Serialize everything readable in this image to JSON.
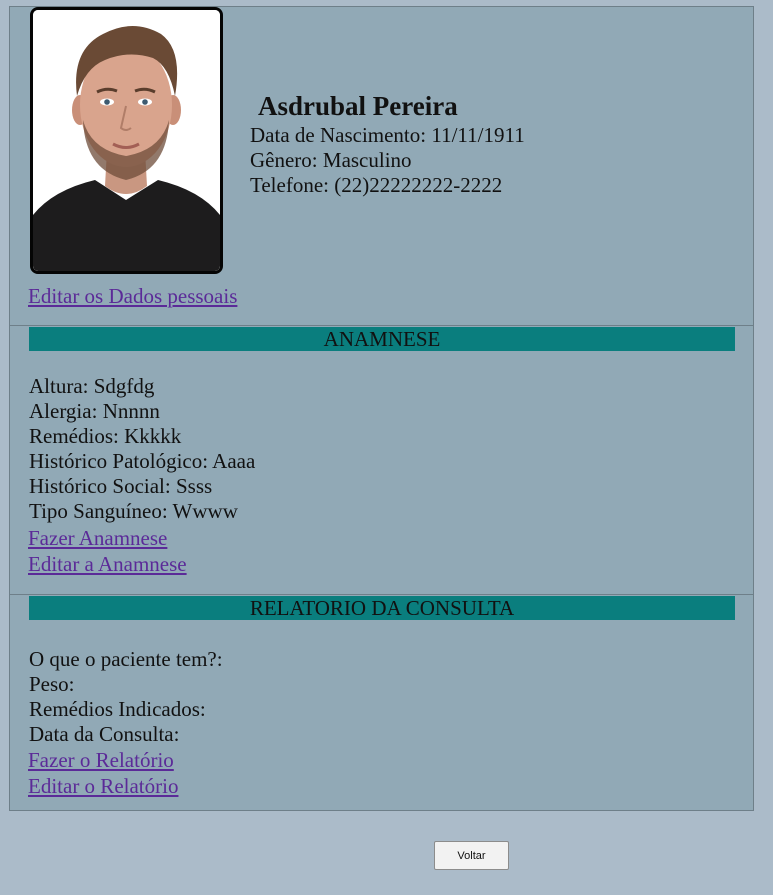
{
  "profile": {
    "name": "Asdrubal Pereira",
    "birth_label": "Data de Nascimento:",
    "birth_value": "11/11/1911",
    "gender_label": "Gênero:",
    "gender_value": "Masculino",
    "phone_label": "Telefone:",
    "phone_value": "(22)22222222-2222",
    "edit_link": "Editar os Dados pessoais"
  },
  "anamnese": {
    "title": "ANAMNESE",
    "fields": [
      {
        "label": "Altura:",
        "value": "Sdgfdg"
      },
      {
        "label": "Alergia:",
        "value": "Nnnnn"
      },
      {
        "label": "Remédios:",
        "value": "Kkkkk"
      },
      {
        "label": "Histórico Patológico:",
        "value": "Aaaa"
      },
      {
        "label": "Histórico Social:",
        "value": "Ssss"
      },
      {
        "label": "Tipo Sanguíneo:",
        "value": "Wwww"
      }
    ],
    "create_link": "Fazer Anamnese",
    "edit_link": "Editar a Anamnese"
  },
  "relatorio": {
    "title": "RELATORIO DA CONSULTA",
    "fields": [
      {
        "label": "O que o paciente tem?:",
        "value": ""
      },
      {
        "label": "Peso:",
        "value": ""
      },
      {
        "label": "Remédios Indicados:",
        "value": ""
      },
      {
        "label": "Data da Consulta:",
        "value": ""
      }
    ],
    "create_link": "Fazer o Relatório",
    "edit_link": "Editar o Relatório"
  },
  "footer": {
    "back_label": "Voltar"
  },
  "colors": {
    "page_bg": "#abbbc9",
    "panel_bg": "#91a9b6",
    "band_bg": "#0a7e7e",
    "link": "#5b2a98"
  }
}
